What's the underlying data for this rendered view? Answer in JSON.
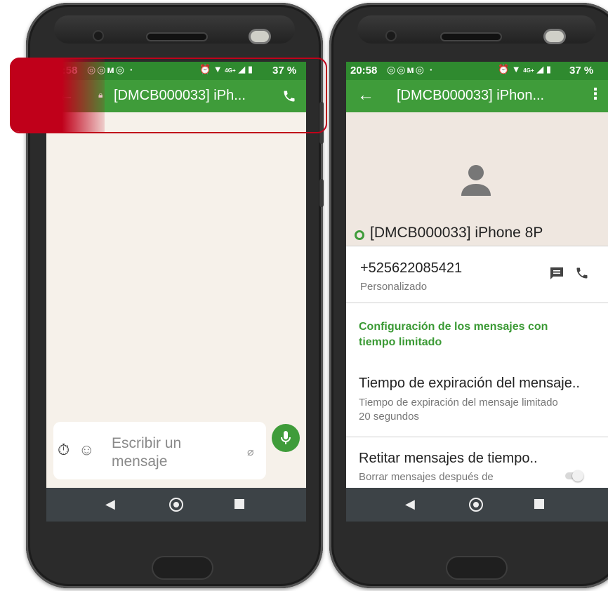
{
  "status": {
    "time": "20:58",
    "battery": "37 %",
    "network": "4G+"
  },
  "chat": {
    "title": "[DMCB000033] iPh...",
    "input_placeholder": "Escribir un mensaje"
  },
  "info": {
    "header_title": "[DMCB000033] iPhon...",
    "contact_name": "[DMCB000033] iPhone 8P",
    "phone_number": "+525622085421",
    "phone_label": "Personalizado",
    "section_title": "Configuración de los mensajes con tiempo limitado",
    "expiration_title": "Tiempo de expiración del mensaje..",
    "expiration_sub": "Tiempo de expiración del mensaje limitado 20 segundos",
    "remove_title": "Retitar mensajes de tiempo..",
    "remove_sub": "Borrar mensajes después de"
  },
  "colors": {
    "accent": "#3f9c3a",
    "status": "#2f8a2f",
    "highlight": "#c0001a"
  }
}
